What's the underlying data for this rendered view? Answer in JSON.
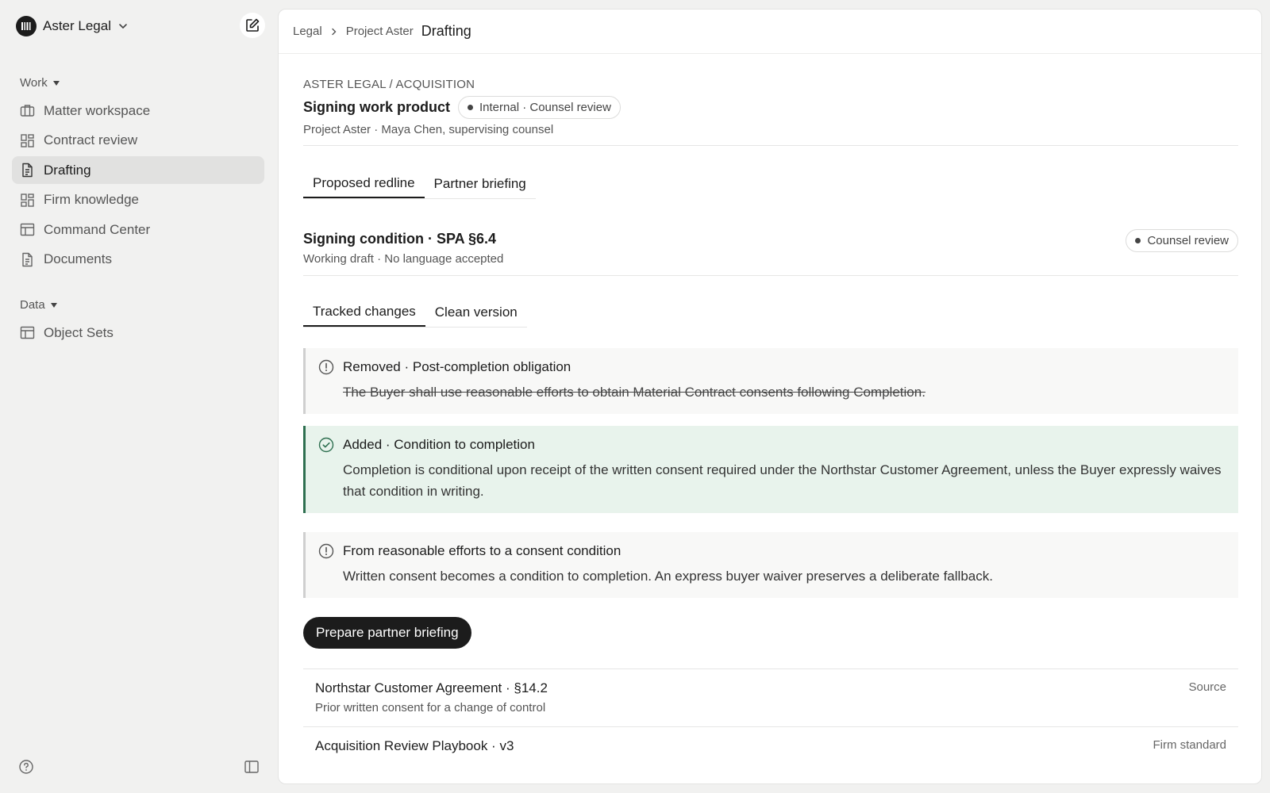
{
  "workspace": {
    "name": "Aster Legal"
  },
  "sidebar": {
    "work_label": "Work",
    "work_items": [
      {
        "label": "Matter workspace",
        "icon": "briefcase-icon"
      },
      {
        "label": "Contract review",
        "icon": "grid-icon"
      },
      {
        "label": "Drafting",
        "icon": "document-icon",
        "active": true
      },
      {
        "label": "Firm knowledge",
        "icon": "grid-icon"
      },
      {
        "label": "Command Center",
        "icon": "table-icon"
      },
      {
        "label": "Documents",
        "icon": "document-icon"
      }
    ],
    "data_label": "Data",
    "data_items": [
      {
        "label": "Object Sets",
        "icon": "table-icon"
      }
    ]
  },
  "breadcrumb": {
    "items": [
      "Legal",
      "Project Aster"
    ],
    "current": "Drafting"
  },
  "header": {
    "eyebrow": "ASTER LEGAL / ACQUISITION",
    "title": "Signing work product",
    "badge": "Internal · Counsel review",
    "meta": "Project Aster · Maya Chen, supervising counsel"
  },
  "tabs": [
    {
      "label": "Proposed redline",
      "active": true
    },
    {
      "label": "Partner briefing",
      "active": false
    }
  ],
  "section": {
    "title": "Signing condition · SPA §6.4",
    "subtitle": "Working draft · No language accepted",
    "badge": "Counsel review"
  },
  "subtabs": [
    {
      "label": "Tracked changes",
      "active": true
    },
    {
      "label": "Clean version",
      "active": false
    }
  ],
  "changes": [
    {
      "kind": "removed",
      "icon": "alert-circle-icon",
      "title": "Removed · Post-completion obligation",
      "body": "The Buyer shall use reasonable efforts to obtain Material Contract consents following Completion."
    },
    {
      "kind": "added",
      "icon": "check-circle-icon",
      "title": "Added · Condition to completion",
      "body": "Completion is conditional upon receipt of the written consent required under the Northstar Customer Agreement, unless the Buyer expressly waives that condition in writing."
    },
    {
      "kind": "note",
      "icon": "alert-circle-icon",
      "title": "From reasonable efforts to a consent condition",
      "body": "Written consent becomes a condition to completion. An express buyer waiver preserves a deliberate fallback."
    }
  ],
  "cta_label": "Prepare partner briefing",
  "sources": [
    {
      "title": "Northstar Customer Agreement · §14.2",
      "subtitle": "Prior written consent for a change of control",
      "tag": "Source"
    },
    {
      "title": "Acquisition Review Playbook · v3",
      "subtitle": "",
      "tag": "Firm standard"
    }
  ],
  "colors": {
    "added_bg": "#e8f3ec",
    "added_border": "#2e6f50",
    "primary": "#1c1c1c"
  }
}
